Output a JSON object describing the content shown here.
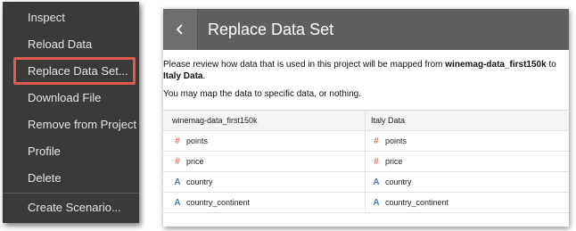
{
  "menu": {
    "items": [
      {
        "label": "Inspect"
      },
      {
        "label": "Reload Data"
      },
      {
        "label": "Replace Data Set..."
      },
      {
        "label": "Download File"
      },
      {
        "label": "Remove from Project"
      },
      {
        "label": "Profile"
      },
      {
        "label": "Delete"
      },
      {
        "label": "Create Scenario..."
      }
    ],
    "highlighted_item": "Replace Data Set...",
    "highlight_color": "#e05a4e"
  },
  "dialog": {
    "back_icon": "chevron-left-icon",
    "title": "Replace Data Set",
    "desc_prefix": "Please review how data that is used in this project will be mapped from ",
    "source_name": "winemag-data_first150k",
    "desc_mid": " to ",
    "target_name": "Italy Data",
    "desc_suffix": ".",
    "desc2": "You may map the data to specific data, or nothing.",
    "table": {
      "headers": [
        "winemag-data_first150k",
        "Italy Data"
      ],
      "rows": [
        {
          "type": "number",
          "icon": "#",
          "source": "points",
          "target": "points"
        },
        {
          "type": "number",
          "icon": "#",
          "source": "price",
          "target": "price"
        },
        {
          "type": "text",
          "icon": "A",
          "source": "country",
          "target": "country"
        },
        {
          "type": "text",
          "icon": "A",
          "source": "country_continent",
          "target": "country_continent"
        }
      ]
    }
  }
}
